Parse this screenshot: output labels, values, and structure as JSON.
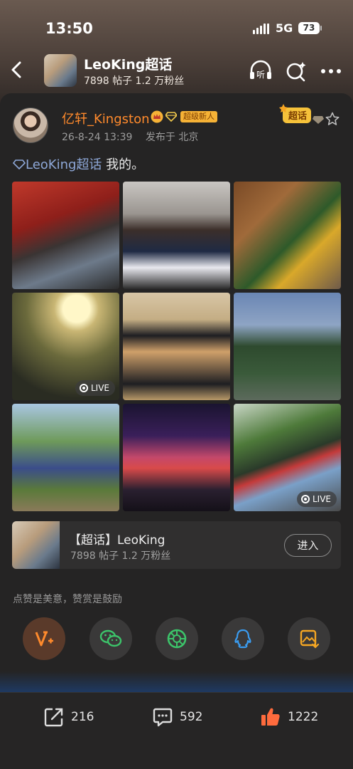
{
  "status_bar": {
    "time": "13:50",
    "network": "5G",
    "battery": "73"
  },
  "header": {
    "title": "LeoKing超话",
    "subtitle": "7898 帖子 1.2 万粉丝",
    "listen_icon_text": "听"
  },
  "post": {
    "username": "亿轩_Kingston",
    "badge_new": "超级新人",
    "date": "26-8-24 13:39",
    "location": "发布于 北京",
    "chaohua_tag": "超话",
    "topic_link": "LeoKing超话",
    "text": " 我的。",
    "live_label": "LIVE"
  },
  "topic_card": {
    "title": "【超话】LeoKing",
    "subtitle": "7898 帖子 1.2 万粉丝",
    "enter_label": "进入"
  },
  "reward_hint": "点赞是美意，赞赏是鼓励",
  "share_icons": [
    "v-plus-icon",
    "wechat-icon",
    "moments-icon",
    "qq-icon",
    "save-image-icon"
  ],
  "actions": {
    "repost_count": "216",
    "comment_count": "592",
    "like_count": "1222"
  },
  "colors": {
    "username": "#ff8a2c",
    "like": "#ff6b3d",
    "topic_link": "#8ea8d8"
  }
}
